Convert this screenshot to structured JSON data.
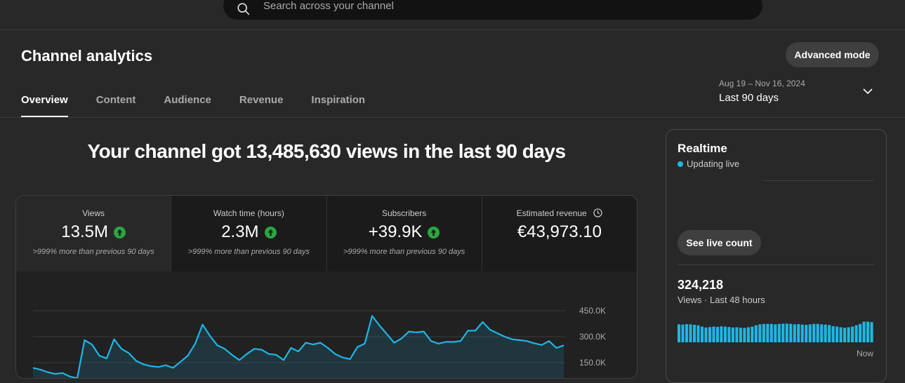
{
  "search": {
    "placeholder": "Search across your channel"
  },
  "page": {
    "title": "Channel analytics",
    "advanced_mode": "Advanced mode"
  },
  "tabs": [
    {
      "label": "Overview",
      "active": true
    },
    {
      "label": "Content",
      "active": false
    },
    {
      "label": "Audience",
      "active": false
    },
    {
      "label": "Revenue",
      "active": false
    },
    {
      "label": "Inspiration",
      "active": false
    }
  ],
  "date_picker": {
    "range": "Aug 19 – Nov 16, 2024",
    "label": "Last 90 days"
  },
  "headline": "Your channel got 13,485,630 views in the last 90 days",
  "metrics": [
    {
      "label": "Views",
      "value": "13.5M",
      "change": ">999% more than previous 90 days",
      "trend": "up"
    },
    {
      "label": "Watch time (hours)",
      "value": "2.3M",
      "change": ">999% more than previous 90 days",
      "trend": "up"
    },
    {
      "label": "Subscribers",
      "value": "+39.9K",
      "change": ">999% more than previous 90 days",
      "trend": "up"
    },
    {
      "label": "Estimated revenue",
      "value": "€43,973.10",
      "change": "",
      "trend": "none"
    }
  ],
  "colors": {
    "accent": "#1fb6e6",
    "up": "#2ba640",
    "background": "#282828"
  },
  "chart_data": {
    "type": "area",
    "y_tick_labels": [
      "450.0K",
      "300.0K",
      "150.0K"
    ],
    "ylim": [
      0,
      450000
    ],
    "grid": true,
    "x": [
      1,
      2,
      3,
      4,
      5,
      6,
      7,
      8,
      9,
      10,
      11,
      12,
      13,
      14,
      15,
      16,
      17,
      18,
      19,
      20,
      21,
      22,
      23,
      24,
      25,
      26,
      27,
      28,
      29,
      30,
      31,
      32,
      33,
      34,
      35,
      36,
      37,
      38,
      39,
      40,
      41,
      42,
      43,
      44,
      45,
      46,
      47,
      48,
      49,
      50,
      51,
      52,
      53,
      54,
      55,
      56,
      57,
      58,
      59,
      60,
      61,
      62,
      63,
      64,
      64,
      65,
      66,
      67,
      68,
      69,
      70,
      71,
      72,
      73,
      74,
      75,
      76,
      77,
      78,
      79,
      80,
      81,
      82,
      83,
      84,
      85,
      86,
      87,
      88,
      89,
      90
    ],
    "values": [
      120000,
      110000,
      95000,
      85000,
      90000,
      70000,
      60000,
      280000,
      255000,
      190000,
      175000,
      285000,
      230000,
      205000,
      160000,
      140000,
      130000,
      125000,
      135000,
      120000,
      155000,
      190000,
      260000,
      370000,
      305000,
      250000,
      230000,
      195000,
      165000,
      200000,
      230000,
      225000,
      200000,
      195000,
      165000,
      235000,
      215000,
      265000,
      255000,
      265000,
      235000,
      200000,
      180000,
      170000,
      240000,
      260000,
      420000,
      365000,
      315000,
      265000,
      290000,
      330000,
      325000,
      330000,
      275000,
      260000,
      270000,
      270000,
      275000,
      335000,
      335000,
      385000,
      340000,
      320000,
      300000,
      285000,
      280000,
      275000,
      262000,
      252000,
      275000,
      235000,
      250000
    ]
  },
  "realtime": {
    "title": "Realtime",
    "status": "Updating live",
    "button": "See live count",
    "count": "324,218",
    "count_label": "Views · Last 48 hours",
    "now_label": "Now",
    "bars": [
      0.8,
      0.79,
      0.81,
      0.8,
      0.78,
      0.76,
      0.7,
      0.66,
      0.68,
      0.7,
      0.69,
      0.71,
      0.7,
      0.68,
      0.66,
      0.67,
      0.65,
      0.64,
      0.67,
      0.7,
      0.76,
      0.8,
      0.82,
      0.82,
      0.82,
      0.8,
      0.82,
      0.83,
      0.83,
      0.82,
      0.8,
      0.81,
      0.79,
      0.78,
      0.8,
      0.82,
      0.82,
      0.8,
      0.79,
      0.77,
      0.72,
      0.7,
      0.67,
      0.65,
      0.67,
      0.7,
      0.76,
      0.82,
      0.92,
      0.92,
      0.9
    ]
  }
}
